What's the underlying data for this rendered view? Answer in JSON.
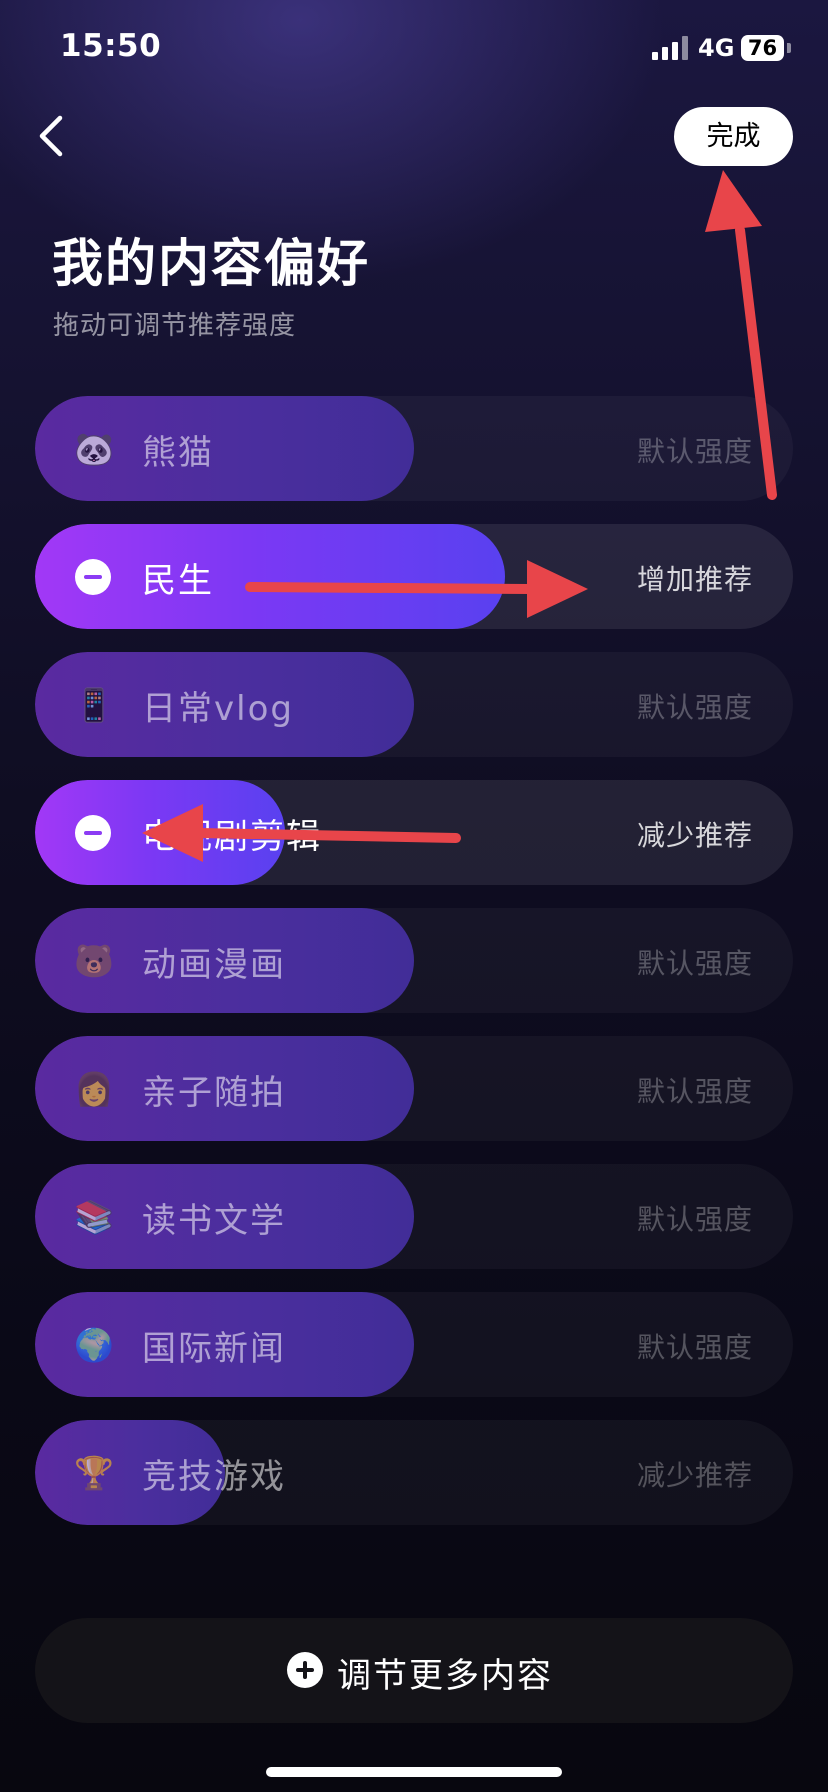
{
  "status_bar": {
    "time": "15:50",
    "network": "4G",
    "battery": "76"
  },
  "header": {
    "done_label": "完成",
    "title": "我的内容偏好",
    "subtitle": "拖动可调节推荐强度"
  },
  "rows": [
    {
      "icon": "panda-emoji-icon",
      "glyph": "🐼",
      "label": "熊猫",
      "status": "默认强度",
      "level": 0.5,
      "active": false
    },
    {
      "icon": "minus-circle-icon",
      "glyph": "",
      "label": "民生",
      "status": "增加推荐",
      "level": 0.62,
      "active": true
    },
    {
      "icon": "phone-emoji-icon",
      "glyph": "📱",
      "label": "日常vlog",
      "status": "默认强度",
      "level": 0.5,
      "active": false
    },
    {
      "icon": "minus-circle-icon",
      "glyph": "",
      "label": "电视剧剪辑",
      "status": "减少推荐",
      "level": 0.33,
      "active": true
    },
    {
      "icon": "bear-emoji-icon",
      "glyph": "🐻",
      "label": "动画漫画",
      "status": "默认强度",
      "level": 0.5,
      "active": false
    },
    {
      "icon": "family-emoji-icon",
      "glyph": "👩",
      "label": "亲子随拍",
      "status": "默认强度",
      "level": 0.5,
      "active": false
    },
    {
      "icon": "books-emoji-icon",
      "glyph": "📚",
      "label": "读书文学",
      "status": "默认强度",
      "level": 0.5,
      "active": false
    },
    {
      "icon": "globe-emoji-icon",
      "glyph": "🌍",
      "label": "国际新闻",
      "status": "默认强度",
      "level": 0.5,
      "active": false
    },
    {
      "icon": "trophy-emoji-icon",
      "glyph": "🏆",
      "label": "竞技游戏",
      "status": "减少推荐",
      "level": 0.25,
      "active": false
    }
  ],
  "more_button": {
    "label": "调节更多内容"
  },
  "colors": {
    "accent": "#a238f6",
    "arrow": "#e8454a",
    "fill_default": "#4b2e9e"
  }
}
